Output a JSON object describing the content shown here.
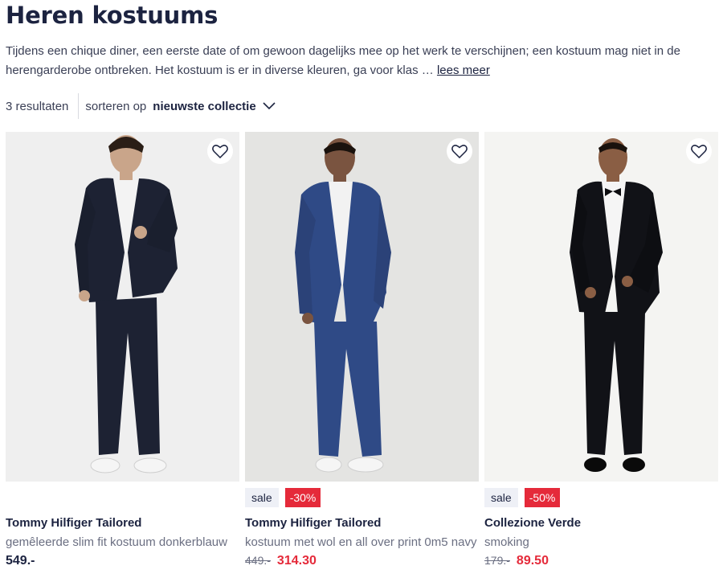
{
  "page": {
    "title": "Heren kostuums",
    "intro": "Tijdens een chique diner, een eerste date of om gewoon dagelijks mee op het werk te verschijnen; een kostuum mag niet in de herengarderobe ontbreken. Het kostuum is er in diverse kleuren, ga voor klas …",
    "read_more": "lees meer"
  },
  "toolbar": {
    "results": "3 resultaten",
    "sort_label": "sorteren op",
    "sort_value": "nieuwste collectie"
  },
  "products": [
    {
      "brand": "Tommy Hilfiger Tailored",
      "description": "gemêleerde slim fit kostuum donkerblauw",
      "price": "549.-",
      "old_price": "",
      "sale_label": "",
      "discount": "",
      "suit_color": "#1d2233",
      "bg_color": "#efefef",
      "icon": "heart-icon"
    },
    {
      "brand": "Tommy Hilfiger Tailored",
      "description": "kostuum met wol en all over print 0m5 navy",
      "price": "314.30",
      "old_price": "449.-",
      "sale_label": "sale",
      "discount": "-30%",
      "suit_color": "#2f4a86",
      "bg_color": "#e4e4e2",
      "icon": "heart-icon"
    },
    {
      "brand": "Collezione Verde",
      "description": "smoking",
      "price": "89.50",
      "old_price": "179.-",
      "sale_label": "sale",
      "discount": "-50%",
      "suit_color": "#111217",
      "bg_color": "#f4f4f2",
      "icon": "heart-icon"
    }
  ],
  "colors": {
    "accent_red": "#e52a3a",
    "navy": "#1c2340"
  }
}
